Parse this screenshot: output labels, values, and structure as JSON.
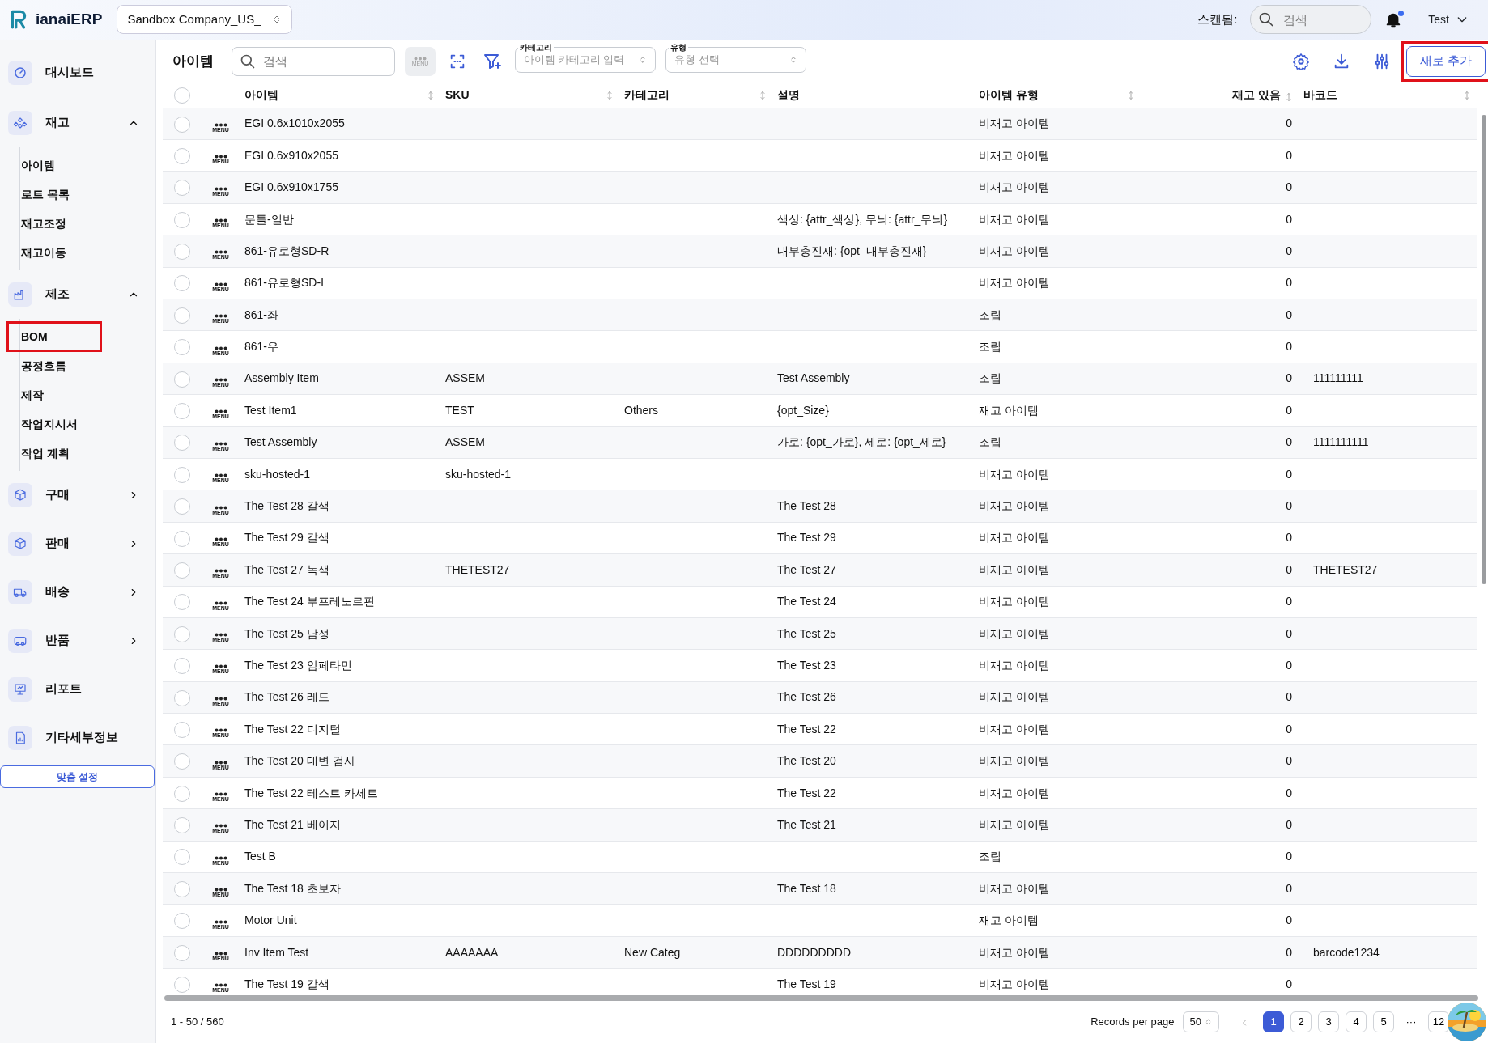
{
  "header": {
    "brand": "ianaiERP",
    "company": "Sandbox Company_US_",
    "scan_label": "스캔됨:",
    "scan_placeholder": "검색",
    "notification_dot": true,
    "user": "Test"
  },
  "sidebar": {
    "items": [
      {
        "label": "대시보드"
      },
      {
        "label": "재고",
        "expanded": true,
        "children": [
          {
            "label": "아이템",
            "highlighted": false
          },
          {
            "label": "로트 목록",
            "highlighted": false
          },
          {
            "label": "재고조정",
            "highlighted": false
          },
          {
            "label": "재고이동",
            "highlighted": false
          }
        ]
      },
      {
        "label": "제조",
        "expanded": true,
        "children": [
          {
            "label": "BOM",
            "highlighted": true
          },
          {
            "label": "공정흐름",
            "highlighted": false
          },
          {
            "label": "제작",
            "highlighted": false
          },
          {
            "label": "작업지시서",
            "highlighted": false
          },
          {
            "label": "작업 계획",
            "highlighted": false
          }
        ]
      },
      {
        "label": "구매",
        "expanded": false
      },
      {
        "label": "판매",
        "expanded": false
      },
      {
        "label": "배송",
        "expanded": false
      },
      {
        "label": "반품",
        "expanded": false
      },
      {
        "label": "리포트"
      },
      {
        "label": "기타세부정보"
      }
    ],
    "custom_button": "맞춤 설정"
  },
  "toolbar": {
    "title": "아이템",
    "search_placeholder": "검색",
    "menu_button": "MENU",
    "category_label": "카테고리",
    "category_placeholder": "아이템 카테고리 입력",
    "type_label": "유형",
    "type_placeholder": "유형 선택",
    "add_button": "새로 추가",
    "add_highlighted": true
  },
  "table": {
    "all_checked": false,
    "columns": [
      {
        "label": "아이템",
        "sortable": true
      },
      {
        "label": "SKU",
        "sortable": true
      },
      {
        "label": "카테고리",
        "sortable": true
      },
      {
        "label": "설명",
        "sortable": false
      },
      {
        "label": "아이템 유형",
        "sortable": true
      },
      {
        "label": "재고 있음",
        "sortable": true
      },
      {
        "label": "바코드",
        "sortable": true
      }
    ],
    "rows": [
      {
        "checked": false,
        "menu_label": "MENU",
        "cells": [
          "EGI 0.6x1010x2055",
          "",
          "",
          "",
          "비재고 아이템",
          "0",
          ""
        ]
      },
      {
        "checked": false,
        "menu_label": "MENU",
        "cells": [
          "EGI 0.6x910x2055",
          "",
          "",
          "",
          "비재고 아이템",
          "0",
          ""
        ]
      },
      {
        "checked": false,
        "menu_label": "MENU",
        "cells": [
          "EGI 0.6x910x1755",
          "",
          "",
          "",
          "비재고 아이템",
          "0",
          ""
        ]
      },
      {
        "checked": false,
        "menu_label": "MENU",
        "cells": [
          "문틀-일반",
          "",
          "",
          "색상: {attr_색상}, 무늬: {attr_무늬}",
          "비재고 아이템",
          "0",
          ""
        ]
      },
      {
        "checked": false,
        "menu_label": "MENU",
        "cells": [
          "861-유로형SD-R",
          "",
          "",
          "내부충진재: {opt_내부충진재}",
          "비재고 아이템",
          "0",
          ""
        ]
      },
      {
        "checked": false,
        "menu_label": "MENU",
        "cells": [
          "861-유로형SD-L",
          "",
          "",
          "",
          "비재고 아이템",
          "0",
          ""
        ]
      },
      {
        "checked": false,
        "menu_label": "MENU",
        "cells": [
          "861-좌",
          "",
          "",
          "",
          "조립",
          "0",
          ""
        ]
      },
      {
        "checked": false,
        "menu_label": "MENU",
        "cells": [
          "861-우",
          "",
          "",
          "",
          "조립",
          "0",
          ""
        ]
      },
      {
        "checked": false,
        "menu_label": "MENU",
        "cells": [
          "Assembly Item",
          "ASSEM",
          "",
          "Test Assembly",
          "조립",
          "0",
          "111111111"
        ]
      },
      {
        "checked": false,
        "menu_label": "MENU",
        "cells": [
          "Test Item1",
          "TEST",
          "Others",
          "{opt_Size}",
          "재고 아이템",
          "0",
          ""
        ]
      },
      {
        "checked": false,
        "menu_label": "MENU",
        "cells": [
          "Test Assembly",
          "ASSEM",
          "",
          "가로: {opt_가로}, 세로: {opt_세로}",
          "조립",
          "0",
          "1111111111"
        ]
      },
      {
        "checked": false,
        "menu_label": "MENU",
        "cells": [
          "sku-hosted-1",
          "sku-hosted-1",
          "",
          "",
          "비재고 아이템",
          "0",
          ""
        ]
      },
      {
        "checked": false,
        "menu_label": "MENU",
        "cells": [
          "The Test 28 갈색",
          "",
          "",
          "The Test 28",
          "비재고 아이템",
          "0",
          ""
        ]
      },
      {
        "checked": false,
        "menu_label": "MENU",
        "cells": [
          "The Test 29 갈색",
          "",
          "",
          "The Test 29",
          "비재고 아이템",
          "0",
          ""
        ]
      },
      {
        "checked": false,
        "menu_label": "MENU",
        "cells": [
          "The Test 27 녹색",
          "THETEST27",
          "",
          "The Test 27",
          "비재고 아이템",
          "0",
          "THETEST27"
        ]
      },
      {
        "checked": false,
        "menu_label": "MENU",
        "cells": [
          "The Test 24 부프레노르핀",
          "",
          "",
          "The Test 24",
          "비재고 아이템",
          "0",
          ""
        ]
      },
      {
        "checked": false,
        "menu_label": "MENU",
        "cells": [
          "The Test 25 남성",
          "",
          "",
          "The Test 25",
          "비재고 아이템",
          "0",
          ""
        ]
      },
      {
        "checked": false,
        "menu_label": "MENU",
        "cells": [
          "The Test 23 암페타민",
          "",
          "",
          "The Test 23",
          "비재고 아이템",
          "0",
          ""
        ]
      },
      {
        "checked": false,
        "menu_label": "MENU",
        "cells": [
          "The Test 26 레드",
          "",
          "",
          "The Test 26",
          "비재고 아이템",
          "0",
          ""
        ]
      },
      {
        "checked": false,
        "menu_label": "MENU",
        "cells": [
          "The Test 22 디지털",
          "",
          "",
          "The Test 22",
          "비재고 아이템",
          "0",
          ""
        ]
      },
      {
        "checked": false,
        "menu_label": "MENU",
        "cells": [
          "The Test 20 대변 검사",
          "",
          "",
          "The Test 20",
          "비재고 아이템",
          "0",
          ""
        ]
      },
      {
        "checked": false,
        "menu_label": "MENU",
        "cells": [
          "The Test 22 테스트 카세트",
          "",
          "",
          "The Test 22",
          "비재고 아이템",
          "0",
          ""
        ]
      },
      {
        "checked": false,
        "menu_label": "MENU",
        "cells": [
          "The Test 21 베이지",
          "",
          "",
          "The Test 21",
          "비재고 아이템",
          "0",
          ""
        ]
      },
      {
        "checked": false,
        "menu_label": "MENU",
        "cells": [
          "Test B",
          "",
          "",
          "",
          "조립",
          "0",
          ""
        ]
      },
      {
        "checked": false,
        "menu_label": "MENU",
        "cells": [
          "The Test 18 초보자",
          "",
          "",
          "The Test 18",
          "비재고 아이템",
          "0",
          ""
        ]
      },
      {
        "checked": false,
        "menu_label": "MENU",
        "cells": [
          "Motor Unit",
          "",
          "",
          "",
          "재고 아이템",
          "0",
          ""
        ]
      },
      {
        "checked": false,
        "menu_label": "MENU",
        "cells": [
          "Inv Item Test",
          "AAAAAAA",
          "New Categ",
          "DDDDDDDDD",
          "비재고 아이템",
          "0",
          "barcode1234"
        ]
      },
      {
        "checked": false,
        "menu_label": "MENU",
        "cells": [
          "The Test 19 갈색",
          "",
          "",
          "The Test 19",
          "비재고 아이템",
          "0",
          ""
        ]
      }
    ]
  },
  "footer": {
    "range": "1 - 50 / 560",
    "per_page_label": "Records per page",
    "per_page": "50",
    "pages": [
      {
        "label": "1",
        "selected": true
      },
      {
        "label": "2",
        "selected": false
      },
      {
        "label": "3",
        "selected": false
      },
      {
        "label": "4",
        "selected": false
      },
      {
        "label": "5",
        "selected": false
      },
      {
        "label": "···",
        "selected": false
      },
      {
        "label": "12",
        "selected": false
      }
    ]
  }
}
